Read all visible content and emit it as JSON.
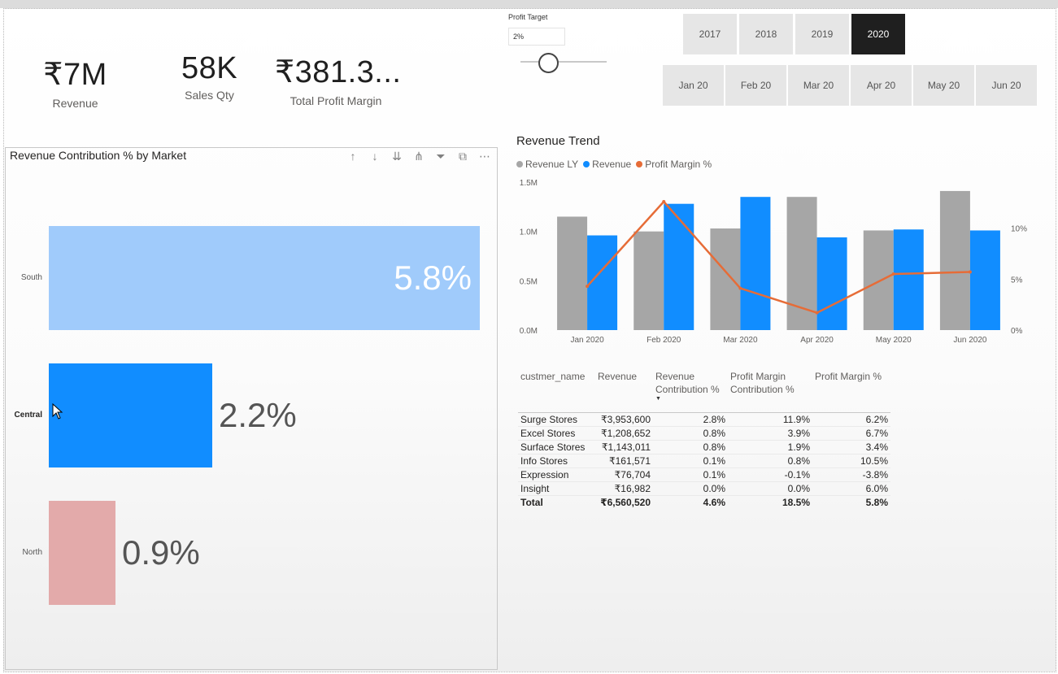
{
  "kpis": [
    {
      "value": "₹7M",
      "label": "Revenue"
    },
    {
      "value": "58K",
      "label": "Sales Qty"
    },
    {
      "value": "₹381.3...",
      "label": "Total Profit Margin"
    }
  ],
  "profit_target": {
    "label": "Profit Target",
    "value": "2%",
    "slider_fraction": 0.3
  },
  "years": [
    {
      "label": "2017",
      "active": false
    },
    {
      "label": "2018",
      "active": false
    },
    {
      "label": "2019",
      "active": false
    },
    {
      "label": "2020",
      "active": true
    }
  ],
  "months": [
    "Jan 20",
    "Feb 20",
    "Mar 20",
    "Apr 20",
    "May 20",
    "Jun 20"
  ],
  "market_chart": {
    "title": "Revenue Contribution % by Market",
    "tool_icons": [
      "arrow-up-icon",
      "arrow-down-icon",
      "double-arrow-down-icon",
      "hierarchy-icon",
      "filter-icon",
      "focus-mode-icon",
      "more-options-icon"
    ]
  },
  "trend": {
    "title": "Revenue Trend",
    "legend": [
      {
        "label": "Revenue LY",
        "color": "#a6a6a6"
      },
      {
        "label": "Revenue",
        "color": "#118dff"
      },
      {
        "label": "Profit Margin %",
        "color": "#e66c37"
      }
    ]
  },
  "table": {
    "headers": [
      "custmer_name",
      "Revenue",
      "Revenue Contribution %",
      "Profit Margin Contribution %",
      "Profit Margin %"
    ],
    "rows": [
      [
        "Surge Stores",
        "₹3,953,600",
        "2.8%",
        "11.9%",
        "6.2%"
      ],
      [
        "Excel Stores",
        "₹1,208,652",
        "0.8%",
        "3.9%",
        "6.7%"
      ],
      [
        "Surface Stores",
        "₹1,143,011",
        "0.8%",
        "1.9%",
        "3.4%"
      ],
      [
        "Info Stores",
        "₹161,571",
        "0.1%",
        "0.8%",
        "10.5%"
      ],
      [
        "Expression",
        "₹76,704",
        "0.1%",
        "-0.1%",
        "-3.8%"
      ],
      [
        "Insight",
        "₹16,982",
        "0.0%",
        "0.0%",
        "6.0%"
      ]
    ],
    "total": [
      "Total",
      "₹6,560,520",
      "4.6%",
      "18.5%",
      "5.8%"
    ]
  },
  "chart_data": [
    {
      "type": "bar",
      "orientation": "horizontal",
      "title": "Revenue Contribution % by Market",
      "categories": [
        "South",
        "Central",
        "North"
      ],
      "values": [
        5.8,
        2.2,
        0.9
      ],
      "labels": [
        "5.8%",
        "2.2%",
        "0.9%"
      ],
      "colors": [
        "#a0cbfb",
        "#118dff",
        "#e3aaaa"
      ],
      "highlighted": "Central",
      "xlim": [
        0,
        5.8
      ]
    },
    {
      "type": "bar",
      "subtype": "combo-column-line",
      "title": "Revenue Trend",
      "categories": [
        "Jan 2020",
        "Feb 2020",
        "Mar 2020",
        "Apr 2020",
        "May 2020",
        "Jun 2020"
      ],
      "series": [
        {
          "name": "Revenue LY",
          "type": "bar",
          "axis": "left",
          "color": "#a6a6a6",
          "values": [
            1.15,
            1.0,
            1.03,
            1.35,
            1.01,
            1.41
          ]
        },
        {
          "name": "Revenue",
          "type": "bar",
          "axis": "left",
          "color": "#118dff",
          "values": [
            0.96,
            1.28,
            1.35,
            0.94,
            1.02,
            1.01
          ]
        },
        {
          "name": "Profit Margin %",
          "type": "line",
          "axis": "right",
          "color": "#e66c37",
          "values": [
            4.3,
            12.6,
            4.1,
            1.7,
            5.5,
            5.7
          ]
        }
      ],
      "y_left": {
        "ticks": [
          0,
          0.5,
          1.0,
          1.5
        ],
        "tick_labels": [
          "0.0M",
          "0.5M",
          "1.0M",
          "1.5M"
        ],
        "range": [
          0,
          1.5
        ]
      },
      "y_right": {
        "ticks": [
          0,
          5,
          10
        ],
        "tick_labels": [
          "0%",
          "5%",
          "10%"
        ],
        "range": [
          0,
          12.6
        ]
      },
      "grid": false,
      "legend": "top-left"
    }
  ]
}
